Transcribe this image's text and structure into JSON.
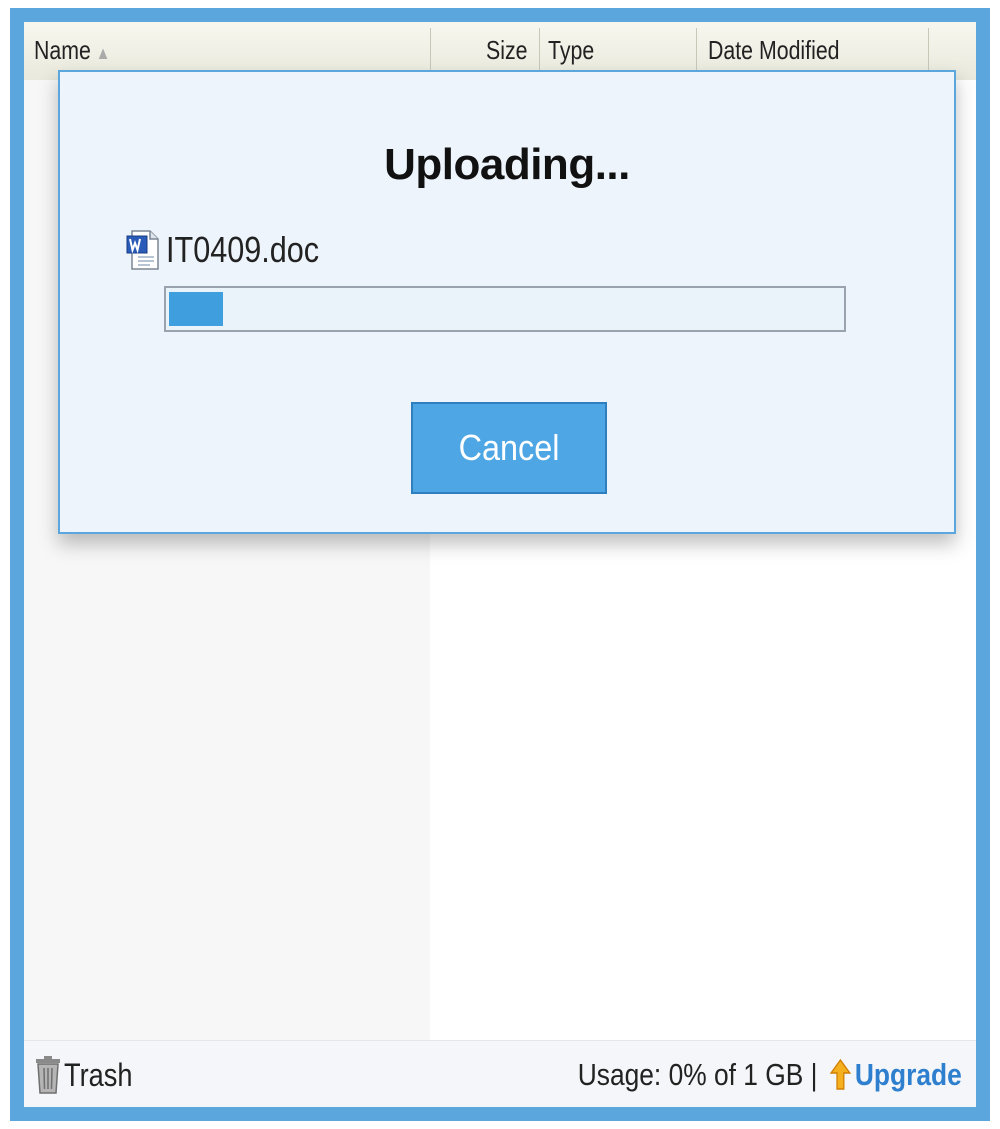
{
  "file_list": {
    "columns": [
      {
        "label": "Name",
        "sorted": "ascending"
      },
      {
        "label": "Size"
      },
      {
        "label": "Type"
      },
      {
        "label": "Date Modified"
      }
    ]
  },
  "upload_dialog": {
    "title": "Uploading...",
    "file_name": "IT0409.doc",
    "file_icon": "word-document-icon",
    "progress_fraction": 0.08,
    "cancel_label": "Cancel"
  },
  "footer": {
    "trash_label": "Trash",
    "usage_text": "Usage: 0% of 1 GB |",
    "upgrade_label": "Upgrade",
    "upgrade_icon": "up-arrow-icon"
  },
  "colors": {
    "frame_border": "#5aa6dd",
    "progress_fill": "#3f9fde",
    "button_bg": "#4ea7e4",
    "link": "#2f7fcf",
    "upgrade_arrow": "#f0a21a"
  }
}
